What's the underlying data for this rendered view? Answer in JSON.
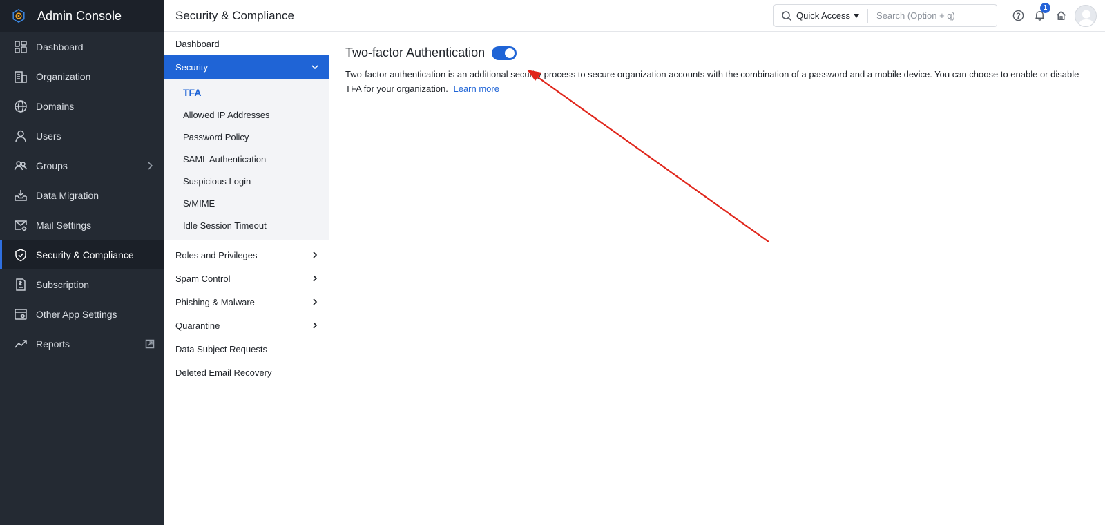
{
  "app": {
    "title": "Admin Console"
  },
  "sidebar": {
    "items": [
      {
        "label": "Dashboard",
        "icon": "dashboard-icon"
      },
      {
        "label": "Organization",
        "icon": "organization-icon"
      },
      {
        "label": "Domains",
        "icon": "globe-icon"
      },
      {
        "label": "Users",
        "icon": "user-icon"
      },
      {
        "label": "Groups",
        "icon": "groups-icon",
        "has_submenu": true
      },
      {
        "label": "Data Migration",
        "icon": "download-tray-icon"
      },
      {
        "label": "Mail Settings",
        "icon": "mail-settings-icon"
      },
      {
        "label": "Security & Compliance",
        "icon": "shield-icon",
        "active": true
      },
      {
        "label": "Subscription",
        "icon": "subscription-icon"
      },
      {
        "label": "Other App Settings",
        "icon": "app-settings-icon"
      },
      {
        "label": "Reports",
        "icon": "trend-icon",
        "external": true
      }
    ]
  },
  "header": {
    "title": "Security & Compliance",
    "quick_access": "Quick Access",
    "search_placeholder": "Search (Option + q)",
    "notification_count": "1"
  },
  "submenu": {
    "dashboard": "Dashboard",
    "security": "Security",
    "security_items": [
      "TFA",
      "Allowed IP Addresses",
      "Password Policy",
      "SAML Authentication",
      "Suspicious Login",
      "S/MIME",
      "Idle Session Timeout"
    ],
    "roles": "Roles and Privileges",
    "spam": "Spam Control",
    "phishing": "Phishing & Malware",
    "quarantine": "Quarantine",
    "dsr": "Data Subject Requests",
    "recovery": "Deleted Email Recovery"
  },
  "main": {
    "heading": "Two-factor Authentication",
    "toggle_on": true,
    "description": "Two-factor authentication is an additional security process to secure organization accounts with the combination of a password and a mobile device. You can choose to enable or disable TFA for your organization.",
    "learn_more": "Learn more"
  },
  "colors": {
    "accent": "#1f64d6",
    "sidebar_bg": "#242a33",
    "annotation_arrow": "#e0261b"
  }
}
